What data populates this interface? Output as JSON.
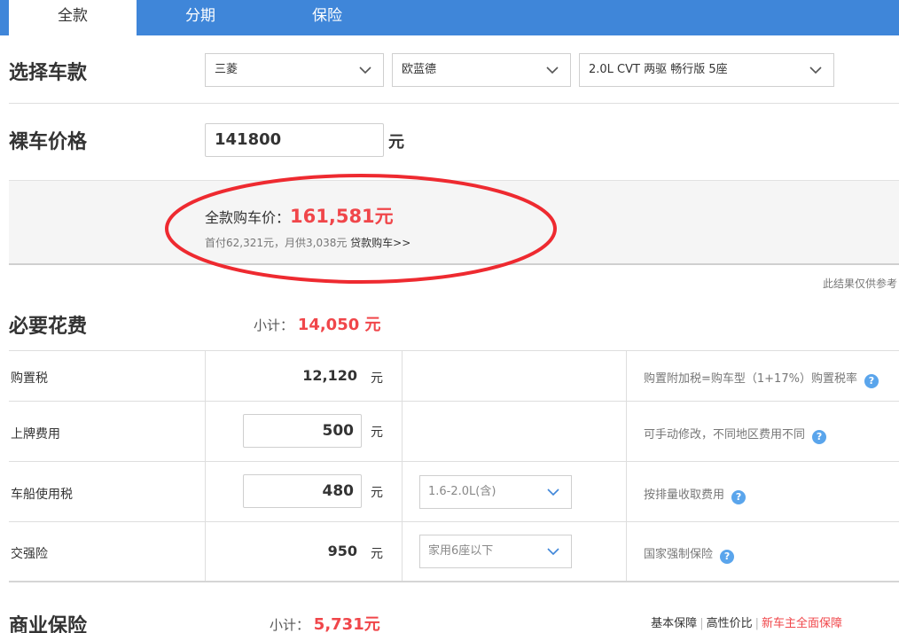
{
  "tabs": [
    {
      "label": "全款",
      "active": true
    },
    {
      "label": "分期",
      "active": false
    },
    {
      "label": "保险",
      "active": false
    }
  ],
  "select_model": {
    "title": "选择车款",
    "brand": "三菱",
    "series": "欧蓝德",
    "model": "2.0L CVT 两驱 畅行版 5座"
  },
  "bare_price": {
    "title": "裸车价格",
    "value": "141800",
    "unit": "元"
  },
  "result": {
    "label": "全款购车价：",
    "price": "161,581元",
    "detail": "首付62,321元，月供3,038元",
    "loan_link": "贷款购车>>",
    "note": "此结果仅供参考"
  },
  "necessary": {
    "title": "必要花费",
    "subtotal_label": "小计：",
    "subtotal_value": "14,050 元",
    "rows": [
      {
        "label": "购置税",
        "amount": "12,120",
        "unit": "元",
        "note": "购置附加税=购车型（1+17%）购置税率"
      },
      {
        "label": "上牌费用",
        "amount": "500",
        "unit": "元",
        "note": "可手动修改，不同地区费用不同"
      },
      {
        "label": "车船使用税",
        "amount": "480",
        "unit": "元",
        "option": "1.6-2.0L(含)",
        "note": "按排量收取费用"
      },
      {
        "label": "交强险",
        "amount": "950",
        "unit": "元",
        "option": "家用6座以下",
        "note": "国家强制保险"
      }
    ]
  },
  "commercial": {
    "title": "商业保险",
    "subtotal_label": "小计：",
    "subtotal_value": "5,731元",
    "links": [
      "基本保障",
      "高性价比",
      "新车主全面保障"
    ]
  },
  "colors": {
    "tab_bar": "#3f86d9",
    "accent_red": "#f0464a",
    "help_icon": "#5aa5ec",
    "annotation_ellipse": "#ee2a30"
  },
  "icons": {
    "dropdown": "chevron-down-icon",
    "help": "question-circle-icon"
  }
}
